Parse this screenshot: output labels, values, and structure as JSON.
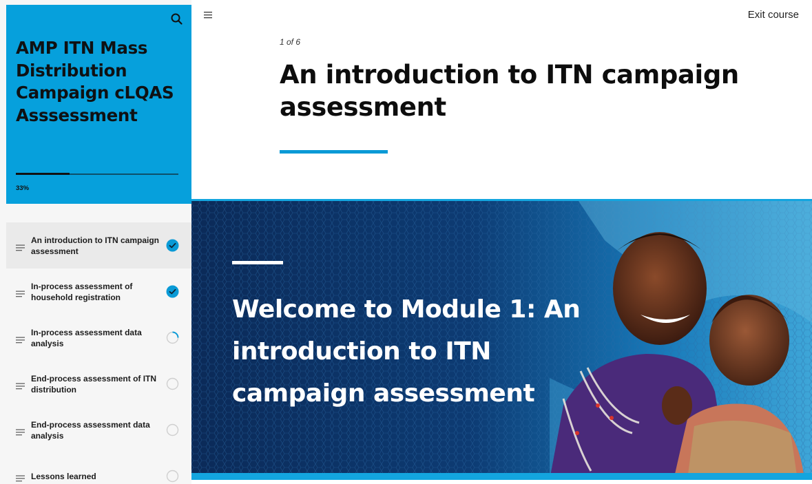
{
  "sidebar": {
    "course_title": "AMP ITN Mass Distribution Campaign cLQAS Asssessment",
    "progress_percent": 33,
    "progress_label": "33%",
    "search_icon": "search-icon",
    "lessons": [
      {
        "label": "An introduction to ITN campaign assessment",
        "status": "complete",
        "active": true
      },
      {
        "label": "In-process assessment of household registration",
        "status": "complete",
        "active": false
      },
      {
        "label": "In-process assessment data analysis",
        "status": "in-progress",
        "active": false
      },
      {
        "label": "End-process assessment of ITN distribution",
        "status": "not-started",
        "active": false
      },
      {
        "label": "End-process assessment data analysis",
        "status": "not-started",
        "active": false
      },
      {
        "label": "Lessons learned",
        "status": "not-started",
        "active": false
      }
    ]
  },
  "topbar": {
    "menu_icon": "hamburger-menu-icon",
    "exit_label": "Exit course"
  },
  "lesson": {
    "count": "1 of 6",
    "title": "An introduction to ITN campaign assessment"
  },
  "banner": {
    "heading": "Welcome to Module 1: An introduction to ITN campaign assessment",
    "image": "mother-and-child-under-mosquito-net"
  },
  "colors": {
    "accent": "#06a0dc",
    "banner_dark": "#0c2c5c",
    "check": "#0a9ad6"
  }
}
